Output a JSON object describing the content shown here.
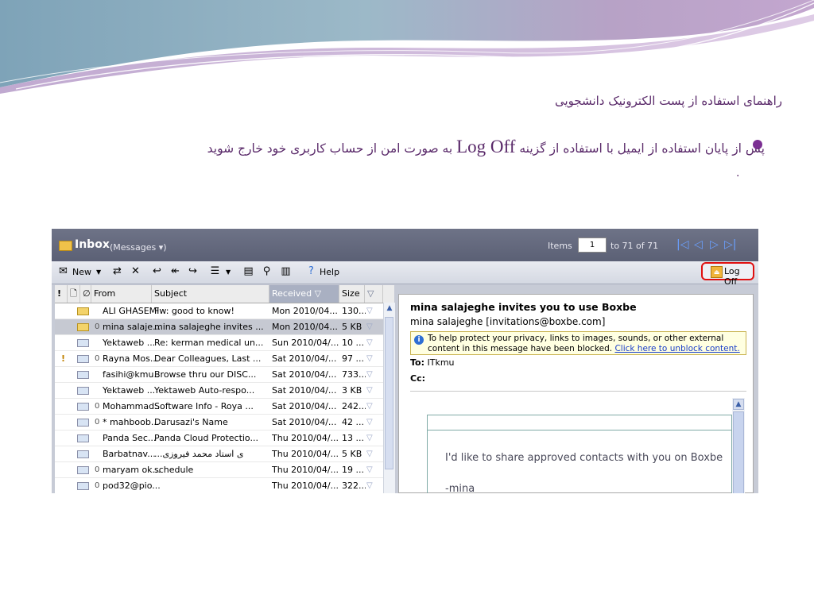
{
  "slide": {
    "title": "راهنمای استفاده از پست الکترونیک دانشجویی",
    "bullet_before": "پس از پایان استفاده از ایمیل با استفاده از گزینه",
    "bullet_latin": "Log Off",
    "bullet_after": "به صورت امن از حساب کاربری خود خارج شوید",
    "bullet_period": ".",
    "accent_color": "#7b2f93"
  },
  "owa": {
    "folder": "Inbox",
    "folder_view": "(Messages ▾)",
    "items_label": "Items",
    "page_value": "1",
    "range_text": "to 71 of 71",
    "toolbar": {
      "new_label": "New",
      "help_label": "Help",
      "logoff_label": "Log Off"
    },
    "columns": [
      "!",
      "",
      "",
      "From",
      "Subject",
      "Received",
      "Size",
      ""
    ],
    "received_sort_indicator": "▽",
    "messages": [
      {
        "importance": "",
        "icon": "unread-envelope-icon",
        "attach": "",
        "from": "ALI GHASEMI",
        "subject": "Fw: good to know!",
        "received": "Mon 2010/04...",
        "size": "130..."
      },
      {
        "importance": "",
        "icon": "unread-envelope-icon",
        "attach": "0",
        "from": "mina salaje...",
        "subject": "mina salajeghe invites ...",
        "received": "Mon 2010/04...",
        "size": "5 KB"
      },
      {
        "importance": "",
        "icon": "replied-envelope-icon",
        "attach": "",
        "from": "Yektaweb ...",
        "subject": "Re: kerman medical un...",
        "received": "Sun 2010/04/...",
        "size": "10 ..."
      },
      {
        "importance": "!",
        "icon": "read-envelope-icon",
        "attach": "0",
        "from": "Rayna Mos...",
        "subject": "Dear Colleagues, Last ...",
        "received": "Sat 2010/04/...",
        "size": "97 ..."
      },
      {
        "importance": "",
        "icon": "read-envelope-icon",
        "attach": "",
        "from": "fasihi@kmu...",
        "subject": "Browse thru our DISC...",
        "received": "Sat 2010/04/...",
        "size": "733..."
      },
      {
        "importance": "",
        "icon": "read-envelope-icon",
        "attach": "",
        "from": "Yektaweb ...",
        "subject": "Yektaweb Auto-respo...",
        "received": "Sat 2010/04/...",
        "size": "3 KB"
      },
      {
        "importance": "",
        "icon": "read-envelope-icon",
        "attach": "0",
        "from": "Mohammad...",
        "subject": "Software Info - Roya ...",
        "received": "Sat 2010/04/...",
        "size": "242..."
      },
      {
        "importance": "",
        "icon": "replied-envelope-icon",
        "attach": "0",
        "from": "* mahboob...",
        "subject": "Darusazi's Name",
        "received": "Sat 2010/04/...",
        "size": "42 ..."
      },
      {
        "importance": "",
        "icon": "read-envelope-icon",
        "attach": "",
        "from": "Panda Sec...",
        "subject": "Panda Cloud Protectio...",
        "received": "Thu 2010/04/...",
        "size": "13 ..."
      },
      {
        "importance": "",
        "icon": "read-envelope-icon",
        "attach": "",
        "from": "Barbatnav...",
        "subject": "...ی استاد محمد فیروزی",
        "received": "Thu 2010/04/...",
        "size": "5 KB"
      },
      {
        "importance": "",
        "icon": "read-envelope-icon",
        "attach": "0",
        "from": "maryam ok...",
        "subject": "schedule",
        "received": "Thu 2010/04/...",
        "size": "19 ..."
      },
      {
        "importance": "",
        "icon": "read-envelope-icon",
        "attach": "0",
        "from": "pod32@pio...",
        "subject": "",
        "received": "Thu 2010/04/...",
        "size": "322..."
      }
    ],
    "reading_pane": {
      "title": "mina salajeghe invites you to use Boxbe",
      "from": "mina salajeghe [invitations@boxbe.com]",
      "info_line1": "To help protect your privacy, links to images, sounds, or other external",
      "info_line2_prefix": "content in this message have been blocked.",
      "info_link": "Click here to unblock content.",
      "to_label": "To:",
      "to_value": "ITkmu",
      "cc_label": "Cc:",
      "body_line1": "I'd like to share approved contacts with you on Boxbe",
      "body_line2": "-mina"
    }
  }
}
